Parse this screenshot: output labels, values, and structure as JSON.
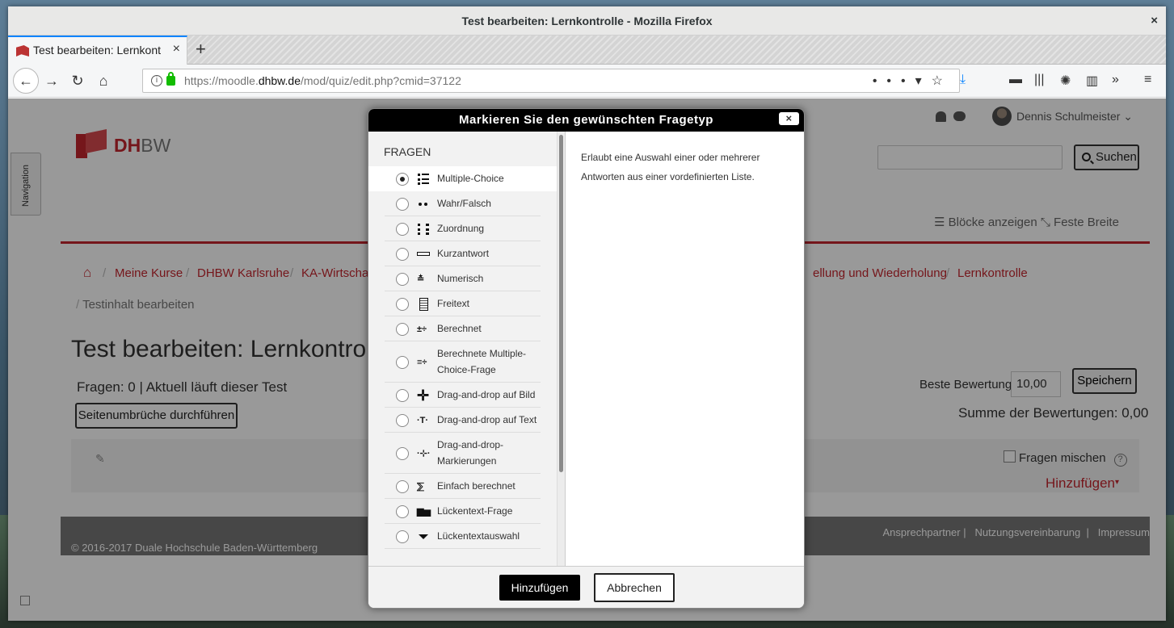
{
  "window": {
    "title": "Test bearbeiten: Lernkontrolle - Mozilla Firefox",
    "close": "×"
  },
  "tab": {
    "title": "Test bearbeiten: Lernkont",
    "close": "×",
    "new": "+"
  },
  "url": {
    "prefix": "https://moodle.",
    "domain": "dhbw.de",
    "path": "/mod/quiz/edit.php?cmid=37122"
  },
  "sidebar_tab": {
    "label": "Navigation"
  },
  "logo": {
    "red": "DH",
    "gray": "BW"
  },
  "user": {
    "name": "Dennis Schulmeister"
  },
  "search": {
    "placeholder": "",
    "button_label": "Suchen"
  },
  "blocks": {
    "show_blocks": "Blöcke anzeigen",
    "fixed_width": "Feste Breite"
  },
  "breadcrumb": {
    "items": [
      "Meine Kurse",
      "DHBW Karlsruhe",
      "KA-Wirtschaft",
      "ellung und Wiederholung",
      "Lernkontrolle"
    ],
    "second_line": "Testinhalt bearbeiten"
  },
  "main": {
    "title": "Test bearbeiten: Lernkontrolle",
    "status": "Fragen: 0 | Aktuell läuft dieser Test",
    "page_breaks_button": "Seitenumbrüche durchführen",
    "max_grade_label": "Beste Bewertung",
    "max_grade_value": "10,00",
    "save_button": "Speichern",
    "total_marks": "Summe der Bewertungen: 0,00",
    "shuffle_label": "Fragen mischen",
    "help": "?",
    "add_link": "Hinzufügen"
  },
  "footer": {
    "copyright": "© 2016-2017 Duale Hochschule Baden-Württemberg",
    "links": [
      "Ansprechpartner",
      "Nutzungsvereinbarung",
      "Impressum"
    ]
  },
  "dialog": {
    "title": "Markieren Sie den gewünschten Fragetyp",
    "close": "×",
    "category": "FRAGEN",
    "description": "Erlaubt eine Auswahl einer oder mehrerer Antworten aus einer vordefinierten Liste.",
    "selected_index": 0,
    "question_types": [
      {
        "label": "Multiple-Choice",
        "icon": "list-icon"
      },
      {
        "label": "Wahr/Falsch",
        "icon": "dots-icon"
      },
      {
        "label": "Zuordnung",
        "icon": "matching-icon"
      },
      {
        "label": "Kurzantwort",
        "icon": "short-answer-icon"
      },
      {
        "label": "Numerisch",
        "icon": "numerical-icon"
      },
      {
        "label": "Freitext",
        "icon": "essay-icon"
      },
      {
        "label": "Berechnet",
        "icon": "calculated-icon"
      },
      {
        "label": "Berechnete Multiple-Choice-Frage",
        "icon": "calculated-multi-icon"
      },
      {
        "label": "Drag-and-drop auf Bild",
        "icon": "move-icon"
      },
      {
        "label": "Drag-and-drop auf Text",
        "icon": "drag-text-icon"
      },
      {
        "label": "Drag-and-drop-Markierungen",
        "icon": "drag-markers-icon"
      },
      {
        "label": "Einfach berechnet",
        "icon": "simple-calculated-icon"
      },
      {
        "label": "Lückentext-Frage",
        "icon": "cloze-icon"
      },
      {
        "label": "Lückentextauswahl",
        "icon": "select-missing-words-icon"
      }
    ],
    "add_button": "Hinzufügen",
    "cancel_button": "Abbrechen"
  }
}
